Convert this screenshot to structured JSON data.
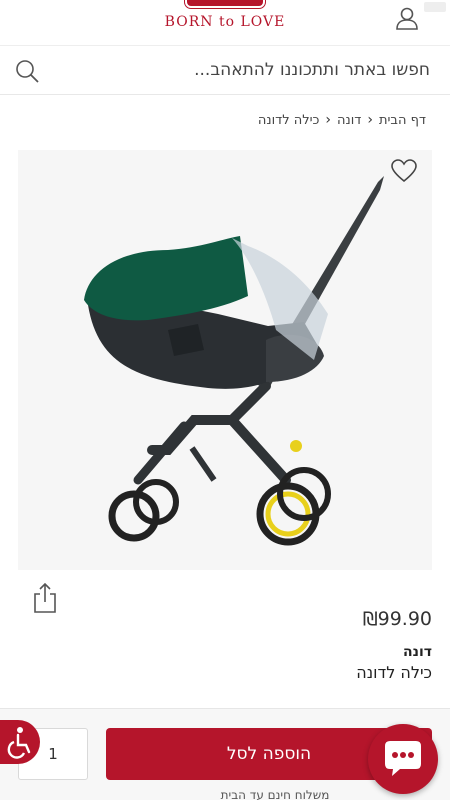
{
  "header": {
    "brand": "BORN to LOVE",
    "icons": {
      "user": "user-icon"
    }
  },
  "search": {
    "placeholder": "חפשו באתר ותתכוננו להתאהב...",
    "icon": "search-icon"
  },
  "breadcrumb": {
    "items": [
      "דף הבית",
      "דונה",
      "כילה לדונה"
    ]
  },
  "product": {
    "price": "₪99.90",
    "brand": "דונה",
    "title": "כילה לדונה",
    "image_alt": "stroller-car-seat-with-green-canopy",
    "wishlist_icon": "heart-icon",
    "share_icon": "share-icon"
  },
  "cart": {
    "quantity": "1",
    "add_label": "הוספה לסל",
    "shipping_note": "משלוח חינם עד הבית"
  },
  "colors": {
    "brand": "#b5152b",
    "canopy": "#0f5a43",
    "frame": "#2f3336",
    "wheel_accent": "#e8d01c"
  }
}
